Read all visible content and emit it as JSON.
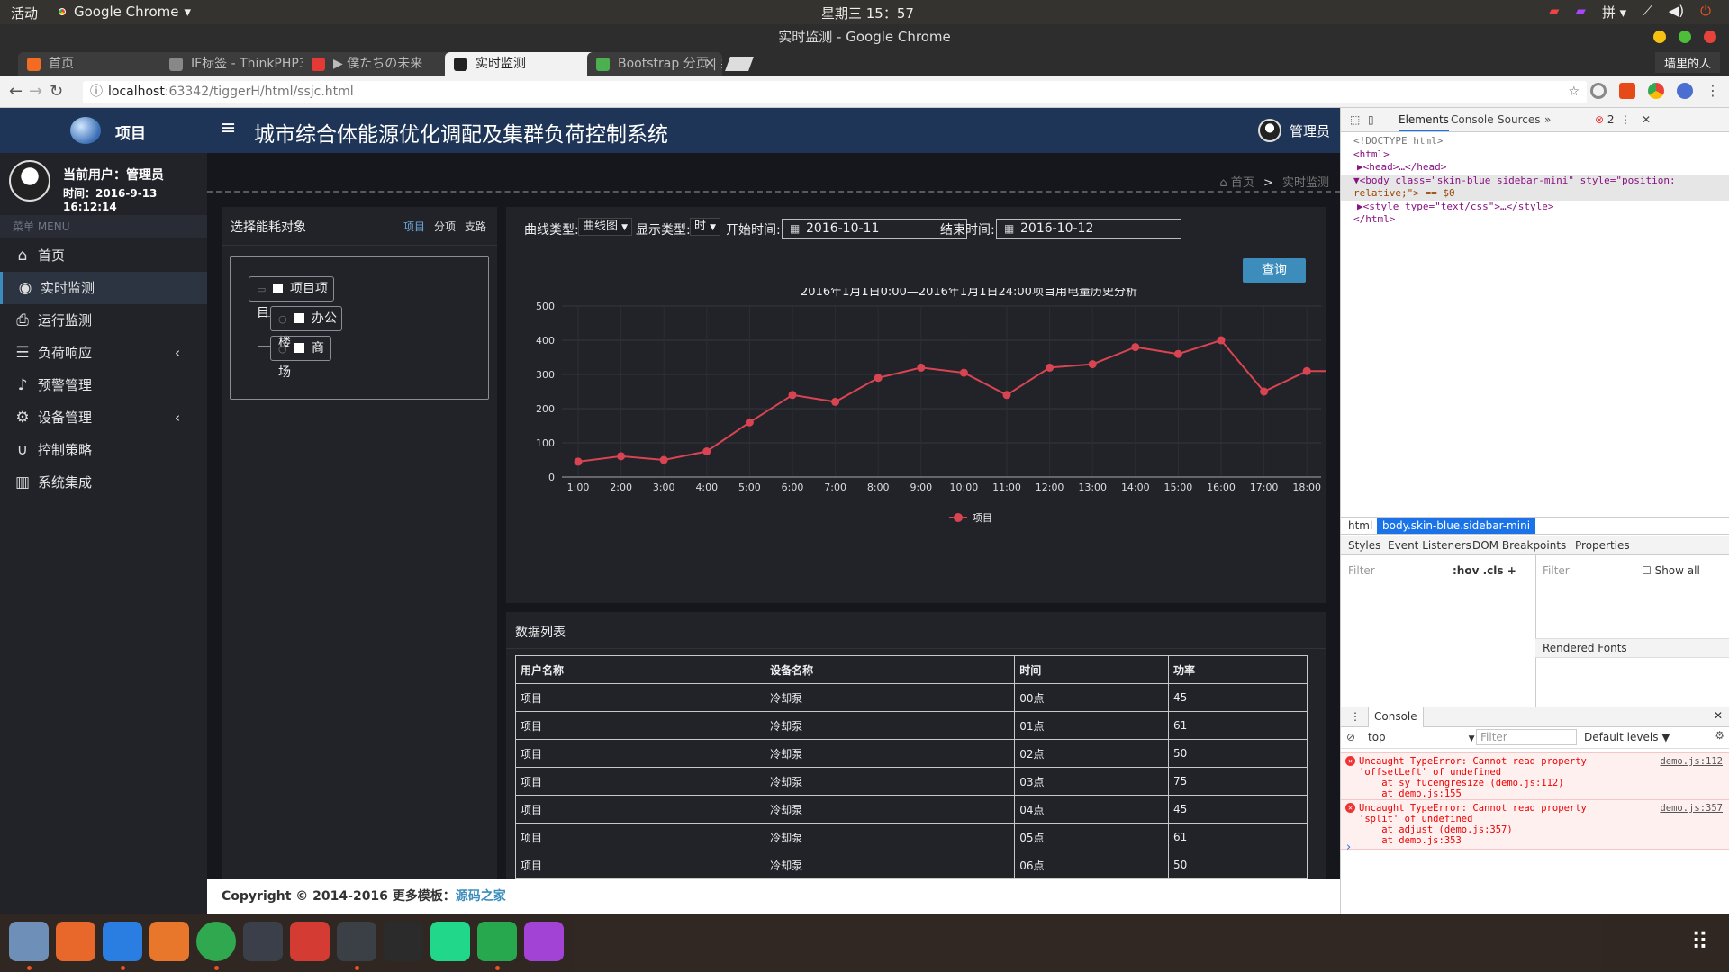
{
  "os": {
    "activities": "活动",
    "app_name": "Google Chrome",
    "clock": "星期三 15：57",
    "tray_input": "拼 ▾"
  },
  "window": {
    "title": "实时监测 - Google Chrome",
    "tabs": [
      {
        "label": "首页",
        "color": "#f36c21"
      },
      {
        "label": "IF标签 - ThinkPHP3",
        "color": "#888888"
      },
      {
        "label": "▶ 僕たちの未来",
        "color": "#e53935"
      },
      {
        "label": "实时监测",
        "color": "#222222"
      },
      {
        "label": "Bootstrap 分页 | 菜",
        "color": "#4caf50"
      }
    ],
    "profile": "墙里的人",
    "url_host": "localhost",
    "url_path": ":63342/tiggerH/html/ssjc.html"
  },
  "app": {
    "brand": "项目",
    "current_user": "当前用户：管理员",
    "time": "时间：2016-9-13 16:12:14",
    "menu_header": "菜单 MENU",
    "menu": [
      {
        "label": "首页",
        "icon": "home-icon",
        "glyph": "⌂",
        "active": false,
        "chevron": false
      },
      {
        "label": "实时监测",
        "icon": "eye-icon",
        "glyph": "◉",
        "active": true,
        "chevron": false
      },
      {
        "label": "运行监测",
        "icon": "print-icon",
        "glyph": "⎙",
        "active": false,
        "chevron": false
      },
      {
        "label": "负荷响应",
        "icon": "sliders-icon",
        "glyph": "☰",
        "active": false,
        "chevron": true
      },
      {
        "label": "预警管理",
        "icon": "bell-icon",
        "glyph": "♪",
        "active": false,
        "chevron": false
      },
      {
        "label": "设备管理",
        "icon": "gears-icon",
        "glyph": "⚙",
        "active": false,
        "chevron": true
      },
      {
        "label": "控制策略",
        "icon": "magnet-icon",
        "glyph": "∪",
        "active": false,
        "chevron": false
      },
      {
        "label": "系统集成",
        "icon": "map-icon",
        "glyph": "▥",
        "active": false,
        "chevron": false
      }
    ],
    "header_title": "城市综合体能源优化调配及集群负荷控制系统",
    "header_user": "管理员",
    "breadcrumb": {
      "home": "首页",
      "sep": ">",
      "current": "实时监测"
    },
    "left_panel": {
      "title": "选择能耗对象",
      "filters": [
        "项目",
        "分项",
        "支路"
      ],
      "tree_root": "项目项目",
      "tree_children": [
        "办公楼",
        "商场"
      ]
    },
    "filters": {
      "curve_type_label": "曲线类型:",
      "curve_type_value": "曲线图",
      "display_type_label": "显示类型:",
      "display_type_value": "时",
      "start_label": "开始时间:",
      "start_value": "2016-10-11",
      "end_label": "结束时间:",
      "end_value": "2016-10-12",
      "query": "查询"
    },
    "table": {
      "title": "数据列表",
      "headers": [
        "用户名称",
        "设备名称",
        "时间",
        "功率"
      ],
      "rows": [
        [
          "项目",
          "冷却泵",
          "00点",
          "45"
        ],
        [
          "项目",
          "冷却泵",
          "01点",
          "61"
        ],
        [
          "项目",
          "冷却泵",
          "02点",
          "50"
        ],
        [
          "项目",
          "冷却泵",
          "03点",
          "75"
        ],
        [
          "项目",
          "冷却泵",
          "04点",
          "45"
        ],
        [
          "项目",
          "冷却泵",
          "05点",
          "61"
        ],
        [
          "项目",
          "冷却泵",
          "06点",
          "50"
        ]
      ]
    },
    "footer_text": "Copyright © 2014-2016 更多模板：",
    "footer_link": "源码之家"
  },
  "chart_data": {
    "type": "line",
    "title": "2016年1月1日0:00—2016年1月1日24:00项目用电量历史分析",
    "categories": [
      "1:00",
      "2:00",
      "3:00",
      "4:00",
      "5:00",
      "6:00",
      "7:00",
      "8:00",
      "9:00",
      "10:00",
      "11:00",
      "12:00",
      "13:00",
      "14:00",
      "15:00",
      "16:00",
      "17:00",
      "18:00"
    ],
    "series": [
      {
        "name": "项目",
        "values": [
          45,
          61,
          50,
          75,
          160,
          240,
          220,
          290,
          320,
          305,
          240,
          320,
          330,
          380,
          360,
          400,
          250,
          310
        ]
      }
    ],
    "ylim": [
      0,
      500
    ],
    "yticks": [
      0,
      100,
      200,
      300,
      400,
      500
    ],
    "grid": true,
    "legend": "bottom",
    "color": "#d94452"
  },
  "devtools": {
    "tabs": [
      "Elements",
      "Console",
      "Sources",
      "»"
    ],
    "error_count": "2",
    "dom_lines": [
      "<!DOCTYPE html>",
      "<html>",
      "▶<head>…</head>",
      "▼<body class=\"skin-blue sidebar-mini\" style=\"position:",
      "relative;\"> == $0",
      "▶<style type=\"text/css\">…</style>",
      "</html>"
    ],
    "breadcrumb": [
      "html",
      "body.skin-blue.sidebar-mini"
    ],
    "style_tabs": [
      "Styles",
      "Event Listeners",
      "DOM Breakpoints",
      "Properties"
    ],
    "filter_placeholder": "Filter",
    "hov_cls": ":hov  .cls  +",
    "show_all": "Show all",
    "rendered_fonts": "Rendered Fonts",
    "console_tab": "Console",
    "context": "top",
    "levels": "Default levels ▼",
    "errors": [
      {
        "lines": [
          "Uncaught TypeError: Cannot read property",
          "'offsetLeft' of undefined",
          "    at sy_fucengresize (demo.js:112)",
          "    at demo.js:155"
        ],
        "src": "demo.js:112"
      },
      {
        "lines": [
          "Uncaught TypeError: Cannot read property",
          "'split' of undefined",
          "    at adjust (demo.js:357)",
          "    at demo.js:353"
        ],
        "src": "demo.js:357"
      }
    ],
    "prompt": "›"
  },
  "dock": [
    {
      "name": "files-icon",
      "color": "#6d8fb8"
    },
    {
      "name": "firefox-icon",
      "color": "#e8672b"
    },
    {
      "name": "wps-writer-icon",
      "color": "#2a7de1"
    },
    {
      "name": "software-center-icon",
      "color": "#e8762b"
    },
    {
      "name": "chrome-icon",
      "color": "#2fa84f"
    },
    {
      "name": "mixer-icon",
      "color": "#3a3f4a"
    },
    {
      "name": "netease-music-icon",
      "color": "#d43c33"
    },
    {
      "name": "sublime-icon",
      "color": "#3b3f46"
    },
    {
      "name": "system-monitor-icon",
      "color": "#2b2b2b"
    },
    {
      "name": "pycharm-icon",
      "color": "#21d789"
    },
    {
      "name": "wps-sheet-icon",
      "color": "#27a84f"
    },
    {
      "name": "phpstorm-icon",
      "color": "#a243d6"
    }
  ]
}
